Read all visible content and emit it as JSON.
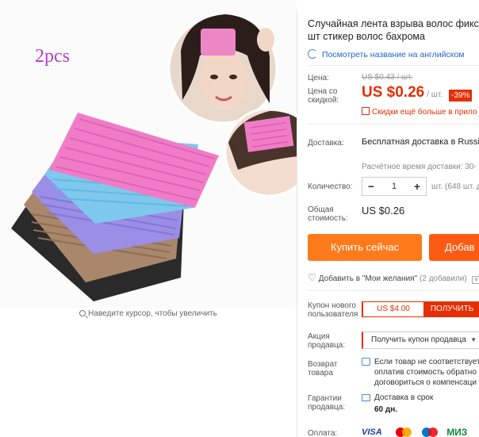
{
  "image": {
    "overlay_text": "2pcs",
    "zoom_hint": "Наведите курсор, чтобы увеличить",
    "colors": {
      "pink": "#f07cc8",
      "blue": "#7ec8ee",
      "purple": "#9b8ee6",
      "tan": "#a8876a",
      "black": "#2a2a2a"
    }
  },
  "product": {
    "title_line1": "Случайная лента взрыва волос фикси",
    "title_line2": "шт стикер волос бахрома",
    "translate_link": "Посмотреть название на английском"
  },
  "price": {
    "old_label": "Цена:",
    "old_value": "US $0.43 / шт.",
    "discount_label_line1": "Цена со",
    "discount_label_line2": "скидкой:",
    "current_value": "US $0.26",
    "current_unit": "/ шт.",
    "discount_badge": "-39%",
    "more_discounts": "Скидки ещё больше в прило"
  },
  "shipping": {
    "label": "Доставка:",
    "value": "Бесплатная доставка в Russia",
    "time": "Расчётное время доставки: 30-"
  },
  "quantity": {
    "label": "Количество:",
    "value": "1",
    "minus": "−",
    "plus": "+",
    "available": "шт. (648 шт. д"
  },
  "total": {
    "label_line1": "Общая",
    "label_line2": "стоимость:",
    "value": "US $0.26"
  },
  "actions": {
    "buy_now": "Купить сейчас",
    "add_to_cart": "Добав",
    "wishlist": "Добавить в \"Мои желания\"",
    "wishlist_count": "(2 добавили)"
  },
  "coupon": {
    "label_line1": "Купон нового",
    "label_line2": "пользователя",
    "value": "US $4.00",
    "get_button": "ПОЛУЧИТЬ"
  },
  "seller_promo": {
    "label_line1": "Акция",
    "label_line2": "продавца:",
    "select": "Получить купон продавца"
  },
  "returns": {
    "label_line1": "Возврат",
    "label_line2": "товара",
    "line1": "Если товар не соответствует",
    "line2": "оплатив стоимость обратно",
    "line3": "договориться о компенсаци"
  },
  "guarantee": {
    "label_line1": "Гарантии",
    "label_line2": "продавца:",
    "text": "Доставка в срок",
    "days": "60 дн."
  },
  "payment": {
    "label": "Оплата:",
    "methods": [
      "VISA",
      "Mastercard",
      "Maestro",
      "МИР"
    ],
    "visa": "VISA",
    "mir": "МИЗ"
  }
}
